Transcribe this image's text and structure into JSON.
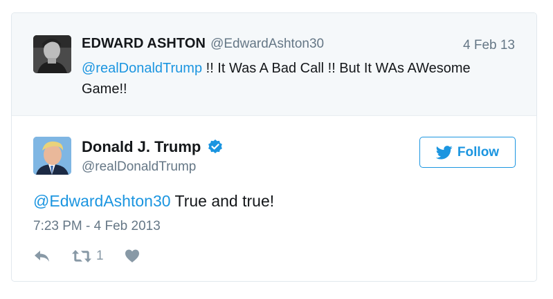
{
  "parent_tweet": {
    "author_name": "EDWARD ASHTON",
    "author_handle": "@EdwardAshton30",
    "date": "4 Feb 13",
    "mention": "@realDonaldTrump",
    "text": " !! It Was A Bad Call !! But It WAs AWesome Game!!"
  },
  "main_tweet": {
    "author_name": "Donald J. Trump",
    "author_handle": "@realDonaldTrump",
    "follow_label": "Follow",
    "mention": "@EdwardAshton30",
    "text": " True and true!",
    "timestamp": "7:23 PM - 4 Feb 2013",
    "retweet_count": "1"
  },
  "colors": {
    "link": "#1b95e0",
    "muted": "#657786",
    "icon": "#8899a6",
    "parent_bg": "#f5f8fa"
  },
  "icons": {
    "verified": "verified-badge-icon",
    "follow": "twitter-bird-icon",
    "reply": "reply-icon",
    "retweet": "retweet-icon",
    "like": "heart-icon"
  }
}
